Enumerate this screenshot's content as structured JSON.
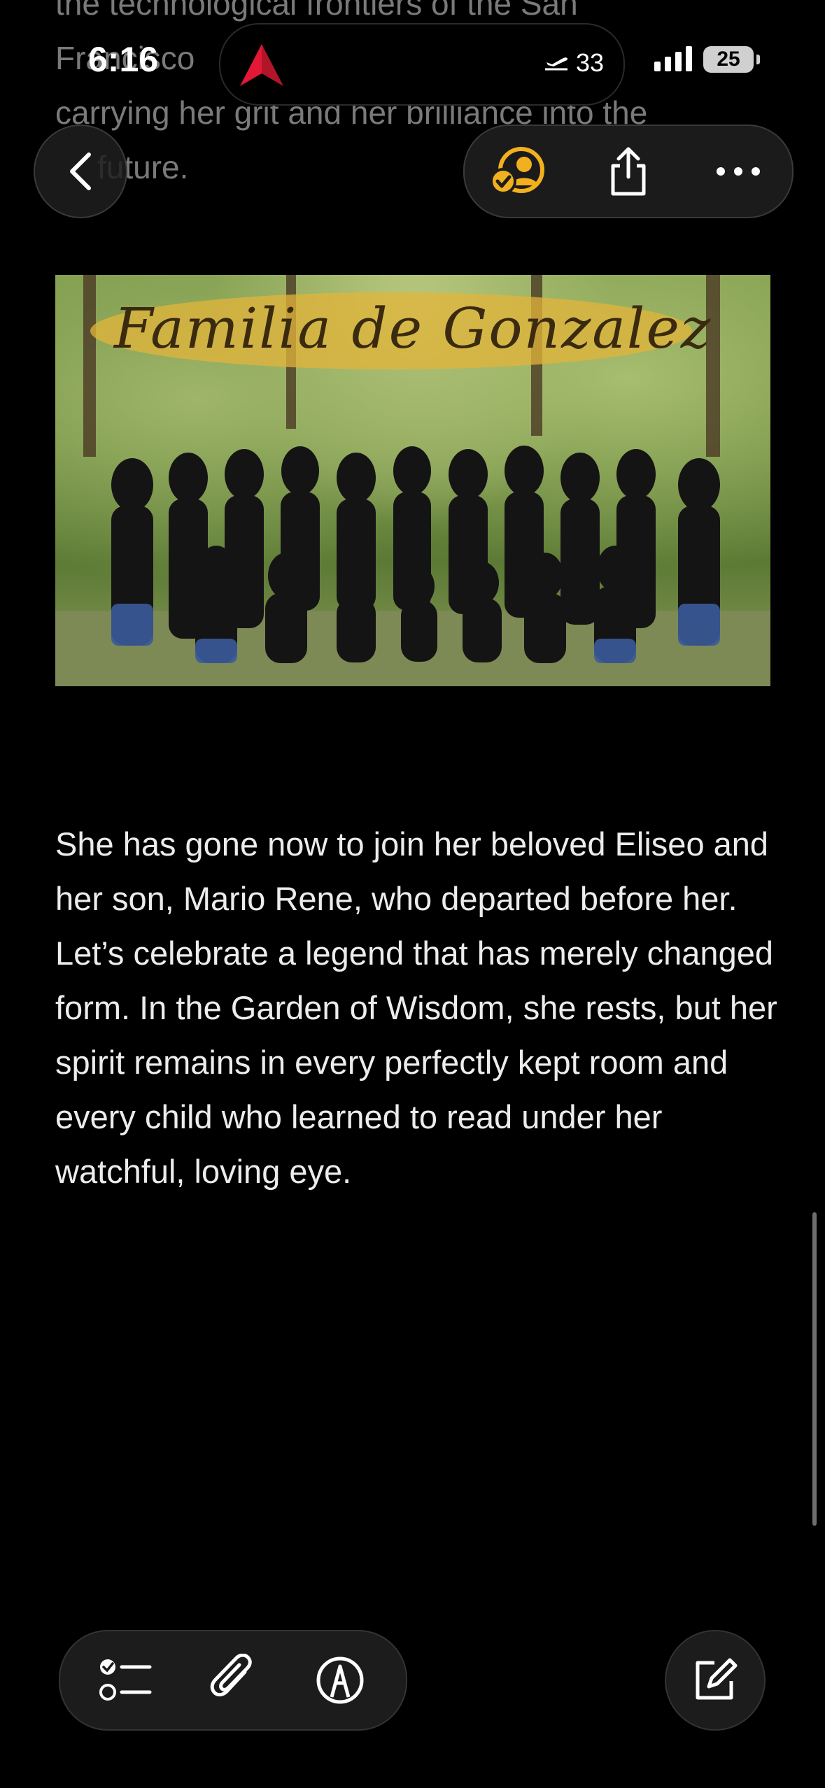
{
  "status_bar": {
    "time": "6:16",
    "flight_count": "33",
    "battery": "25"
  },
  "previous_text": [
    "the technological frontiers of the San",
    "Francisco",
    "carrying her grit and her brilliance into the",
    "future."
  ],
  "photo": {
    "caption": "Familia de Gonzalez"
  },
  "body_text": "She has gone now to join her beloved Eliseo and her son, Mario Rene, who departed before her. Let’s celebrate a legend that has merely changed form. In the Garden of Wisdom, she rests, but her spirit remains in every perfectly kept room and every child who learned to read under her watchful, loving eye.",
  "icons": {
    "back": "chevron-left-icon",
    "collaborate": "person-checkmark-icon",
    "share": "share-icon",
    "more": "ellipsis-icon",
    "checklist": "checklist-icon",
    "attach": "paperclip-icon",
    "markup": "markup-pen-icon",
    "compose": "compose-icon"
  },
  "colors": {
    "background": "#000000",
    "text": "#ececec",
    "accent": "#f2b01e"
  }
}
